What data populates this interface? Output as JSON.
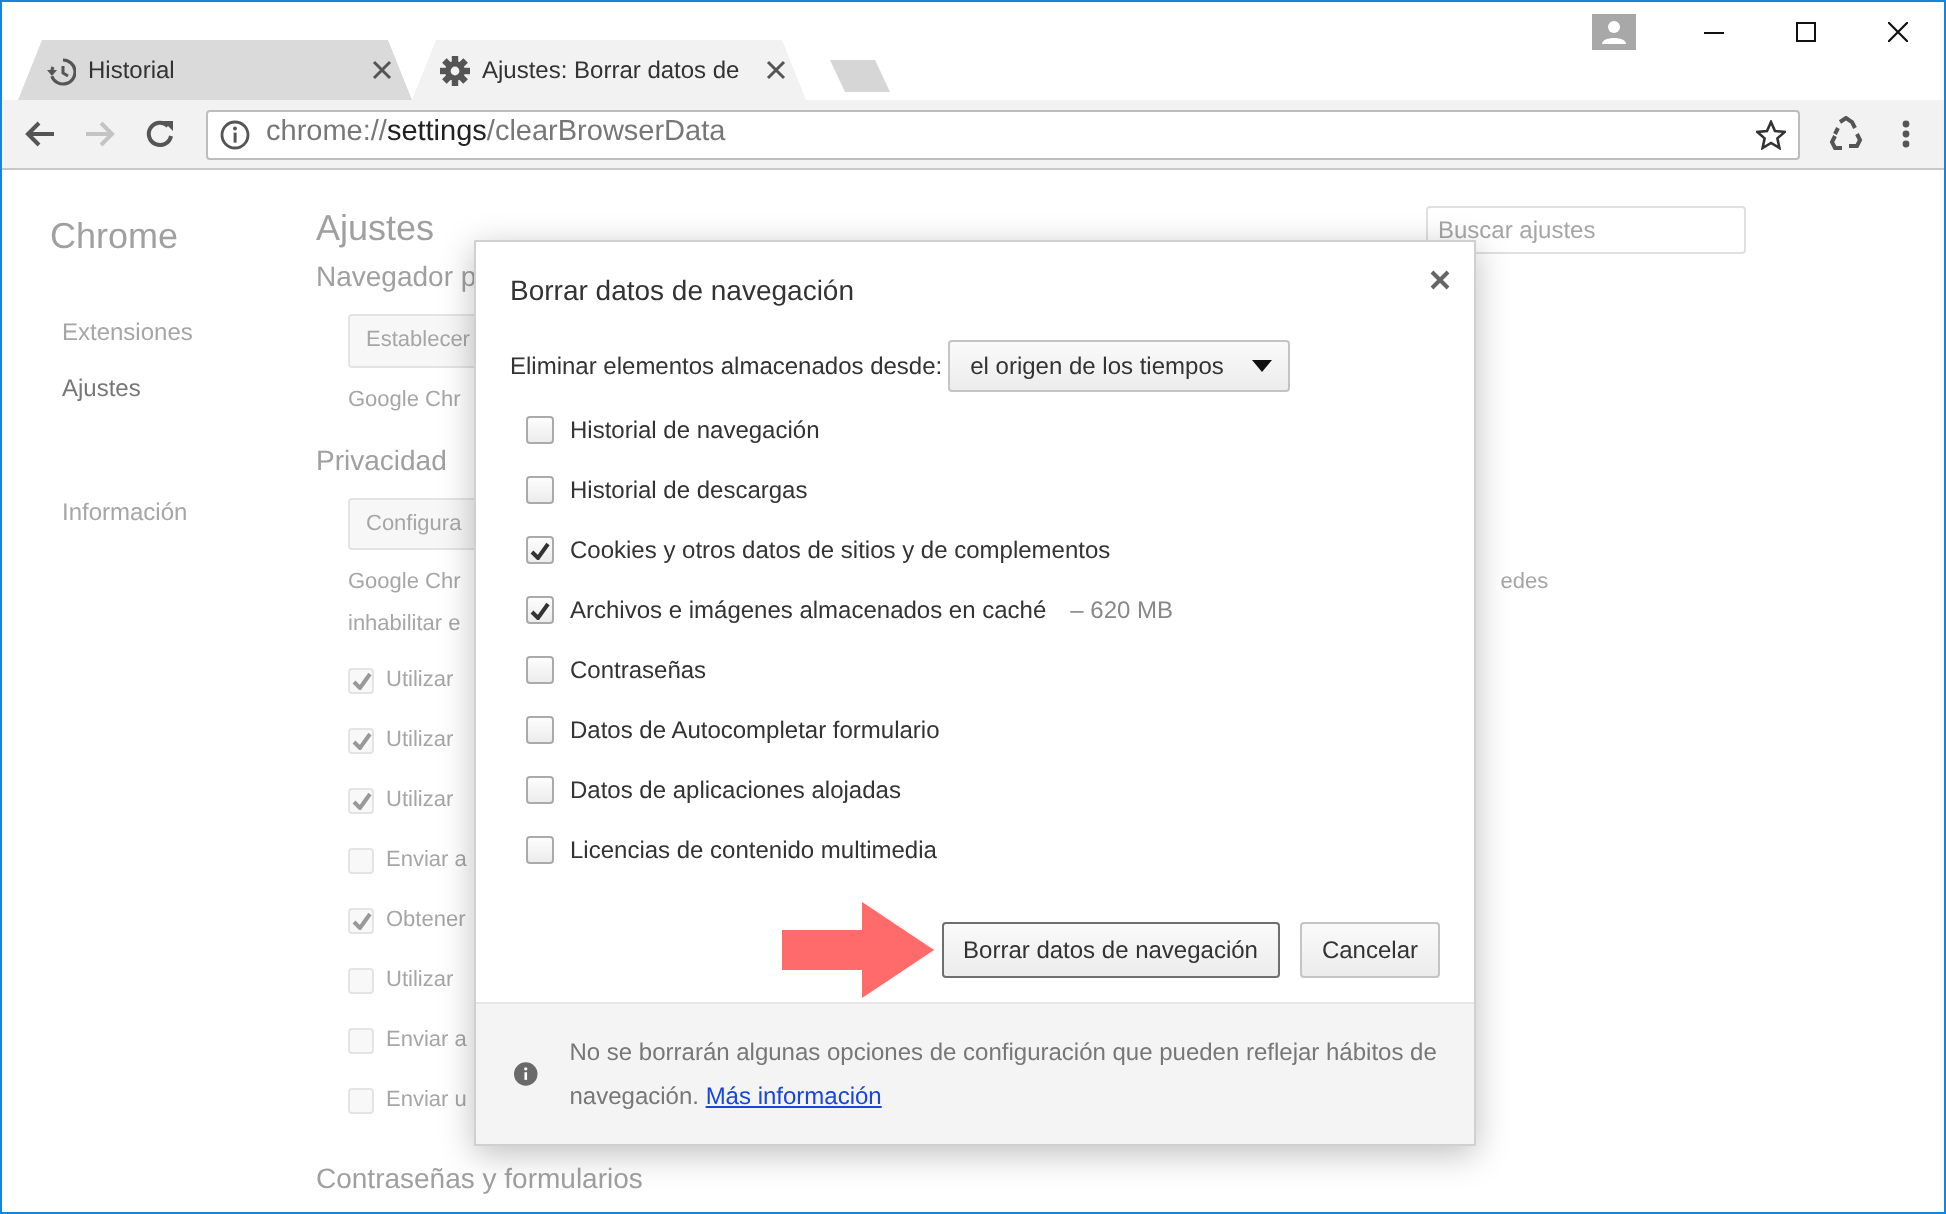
{
  "tabs": [
    {
      "title": "Historial",
      "selected": false
    },
    {
      "title": "Ajustes: Borrar datos de",
      "selected": true
    }
  ],
  "toolbar": {
    "back_enabled": true,
    "forward_enabled": false,
    "address": {
      "scheme": "chrome://",
      "host": "settings",
      "path": "/clearBrowserData"
    }
  },
  "sidebar": {
    "title": "Chrome",
    "items": [
      {
        "label": "Extensiones",
        "selected": false
      },
      {
        "label": "Ajustes",
        "selected": true
      },
      {
        "label": "Información",
        "selected": false
      }
    ]
  },
  "settings": {
    "title": "Ajustes",
    "search_placeholder": "Buscar ajustes",
    "items": [
      {
        "kind": "section",
        "text": "Navegador p"
      },
      {
        "kind": "button",
        "text": "Establecer"
      },
      {
        "kind": "text",
        "text": "Google Chr"
      },
      {
        "kind": "section",
        "text": "Privacidad"
      },
      {
        "kind": "button",
        "text": "Configura"
      },
      {
        "kind": "text",
        "text": "Google Chr",
        "trailing": "edes"
      },
      {
        "kind": "text",
        "text": "inhabilitar e"
      },
      {
        "kind": "checkbox",
        "text": "Utilizar",
        "checked": true
      },
      {
        "kind": "checkbox",
        "text": "Utilizar",
        "checked": true
      },
      {
        "kind": "checkbox",
        "text": "Utilizar",
        "checked": true
      },
      {
        "kind": "checkbox",
        "text": "Enviar a",
        "checked": false
      },
      {
        "kind": "checkbox",
        "text": "Obtener",
        "checked": true
      },
      {
        "kind": "checkbox",
        "text": "Utilizar",
        "checked": false
      },
      {
        "kind": "checkbox",
        "text": "Enviar a",
        "checked": false
      },
      {
        "kind": "checkbox",
        "text": "Enviar u",
        "checked": false
      },
      {
        "kind": "section",
        "text": "Contraseñas y formularios"
      }
    ]
  },
  "dialog": {
    "title": "Borrar datos de navegación",
    "time_range_label": "Eliminar elementos almacenados desde:",
    "time_range_value": "el origen de los tiempos",
    "options": [
      {
        "label": "Historial de navegación",
        "checked": false
      },
      {
        "label": "Historial de descargas",
        "checked": false
      },
      {
        "label": "Cookies y otros datos de sitios y de complementos",
        "checked": true
      },
      {
        "label": "Archivos e imágenes almacenados en caché",
        "detail": "–  620 MB",
        "checked": true
      },
      {
        "label": "Contraseñas",
        "checked": false
      },
      {
        "label": "Datos de Autocompletar formulario",
        "checked": false
      },
      {
        "label": "Datos de aplicaciones alojadas",
        "checked": false
      },
      {
        "label": "Licencias de contenido multimedia",
        "checked": false
      }
    ],
    "buttons": [
      {
        "label": "Borrar datos de navegación",
        "focused": true
      },
      {
        "label": "Cancelar",
        "focused": false
      }
    ],
    "footer": {
      "text": "No se borrarán algunas opciones de configuración que pueden reflejar hábitos de navegación.",
      "link": "Más información"
    }
  }
}
